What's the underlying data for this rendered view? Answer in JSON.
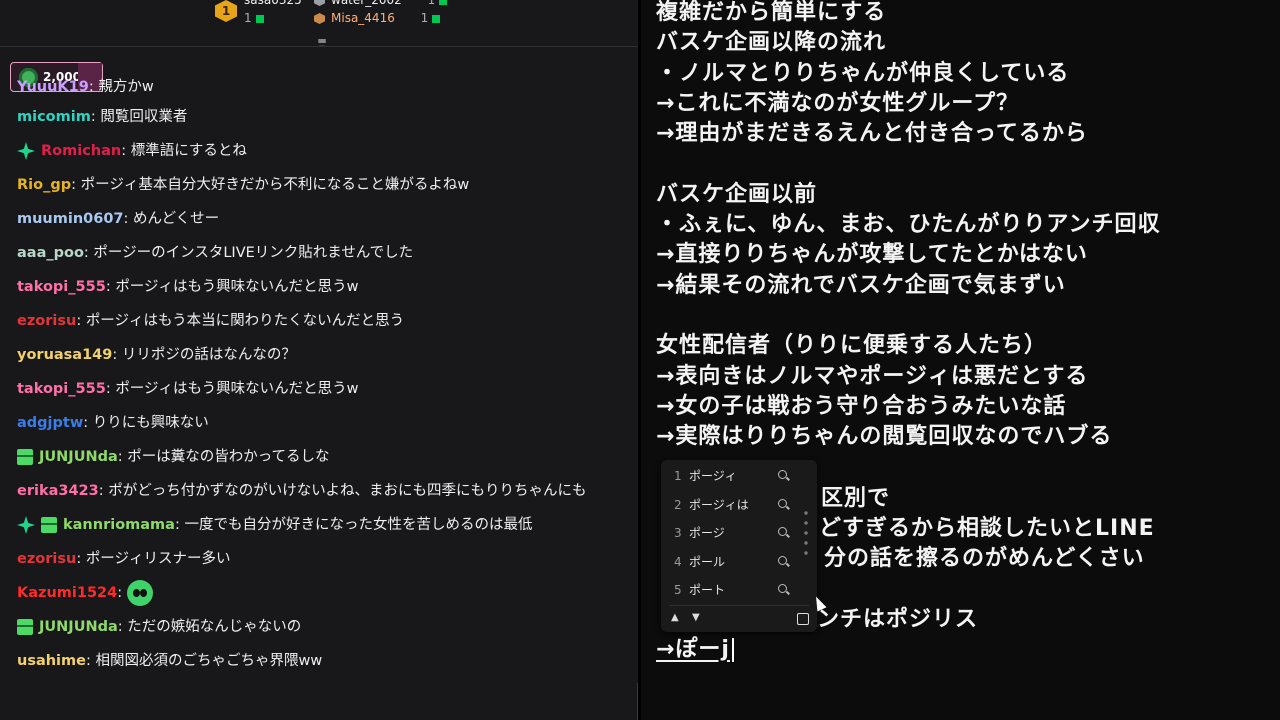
{
  "leaderboard": {
    "rank1": "1",
    "entries": [
      {
        "name": "sasa0325",
        "count": "1"
      },
      {
        "name": "water_2002",
        "count": "1"
      },
      {
        "name": "Misa_4416",
        "count": "1"
      }
    ]
  },
  "channel_points": {
    "value": "2,000"
  },
  "chat": {
    "cut_message": {
      "user": "YuuuK19",
      "text": "親方かw"
    },
    "messages": [
      {
        "user": "micomim",
        "color": "#2fd3c2",
        "text": "閲覧回収業者"
      },
      {
        "user": "Romichan",
        "color": "#e0204a",
        "text": "標準語にするとね",
        "badge": "spark"
      },
      {
        "user": "Rio_gp",
        "color": "#e6b422",
        "text": "ポージィ基本自分大好きだから不利になること嫌がるよねw"
      },
      {
        "user": "muumin0607",
        "color": "#a9c8f0",
        "text": "めんどくせー"
      },
      {
        "user": "aaa_poo",
        "color": "#b8d8c8",
        "text": "ポージーのインスタLIVEリンク貼れませんでした"
      },
      {
        "user": "takopi_555",
        "color": "#ff6fa8",
        "text": "ポージィはもう興味ないんだと思うw"
      },
      {
        "user": "ezorisu",
        "color": "#e2353b",
        "text": "ポージィはもう本当に関わりたくないんだと思う"
      },
      {
        "user": "yoruasa149",
        "color": "#f2d16b",
        "text": "リリポジの話はなんなの？"
      },
      {
        "user": "takopi_555",
        "color": "#ff6fa8",
        "text": "ポージィはもう興味ないんだと思うw"
      },
      {
        "user": "adgjptw",
        "color": "#3a7de6",
        "text": "りりにも興味ない"
      },
      {
        "user": "JUNJUNda",
        "color": "#8fd96a",
        "text": "ポーは糞なの皆わかってるしな",
        "badge": "gift"
      },
      {
        "user": "erika3423",
        "color": "#ff6fa8",
        "text": "ポがどっち付かずなのがいけないよね、まおにも四季にもりりちゃんにも",
        "wrap": true
      },
      {
        "user": "kannriomama",
        "color": "#8fd96a",
        "text": "一度でも自分が好きになった女性を苦しめるのは最低",
        "badge": "spark-gift"
      },
      {
        "user": "ezorisu",
        "color": "#e2353b",
        "text": "ポージィリスナー多い"
      },
      {
        "user": "Kazumi1524",
        "color": "#ff2a2a",
        "text": "",
        "emote": "green-ghost-emote"
      },
      {
        "user": "JUNJUNda",
        "color": "#8fd96a",
        "text": "ただの嫉妬なんじゃないの",
        "badge": "gift"
      },
      {
        "user": "usahime",
        "color": "#f2d16b",
        "text": "相関図必須のごちゃごちゃ界隈ww"
      }
    ]
  },
  "notes": {
    "lines": [
      "複雑だから簡単にする",
      "バスケ企画以降の流れ",
      "・ノルマとりりちゃんが仲良くしている",
      "→これに不満なのが女性グループ？",
      "→理由がまだきるえんと付き合ってるから",
      "",
      "バスケ企画以前",
      "・ふぇに、ゆん、まお、ひたんがりりアンチ回収",
      "→直接りりちゃんが攻撃してたとかはない",
      "→結果その流れでバスケ企画で気まずい",
      "",
      "女性配信者（りりに便乗する人たち）",
      "→表向きはノルマやポージィは悪だとする",
      "→女の子は戦おう守り合おうみたいな話",
      "→実際はりりちゃんの閲覧回収なのでハブる"
    ],
    "partial_lines": [
      "区別で",
      "どすぎるから相談したいとLINE",
      "分の話を擦るのがめんどくさい",
      "ンチはポジリス"
    ],
    "composing": "→ぽーj"
  },
  "ime": {
    "candidates": [
      {
        "num": "1",
        "text": "ポージィ"
      },
      {
        "num": "2",
        "text": "ポージィは"
      },
      {
        "num": "3",
        "text": "ポージ"
      },
      {
        "num": "4",
        "text": "ポール"
      },
      {
        "num": "5",
        "text": "ポート"
      }
    ],
    "up_arrow": "▲",
    "down_arrow": "▼"
  },
  "colors": {
    "chat_bg": "#18181b",
    "notes_bg": "#0c0c0c",
    "points_border": "#e7a2c4"
  }
}
